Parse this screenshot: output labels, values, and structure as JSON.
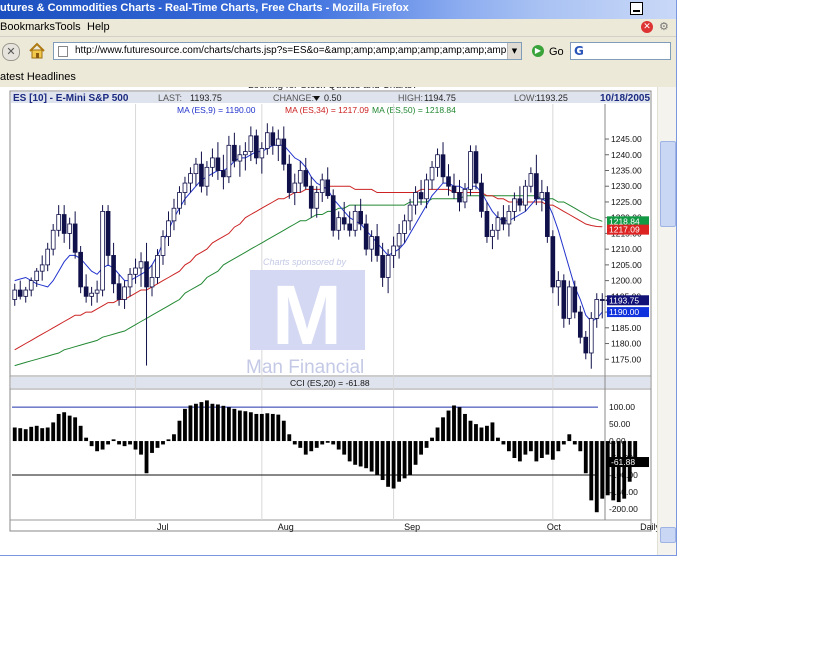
{
  "window": {
    "title": "utures & Commodities Charts - Real-Time Charts, Free Charts - Mozilla Firefox"
  },
  "menu": {
    "bookmarks": "Bookmarks",
    "tools": "Tools",
    "help": "Help"
  },
  "nav": {
    "url": "http://www.futuresource.com/charts/charts.jsp?s=ES&o=&amp;amp;amp;amp;amp;amp;amp;amp;a=D&z=",
    "go": "Go",
    "search_logo": "G"
  },
  "bookmarks_bar": {
    "item": "atest Headlines"
  },
  "page": {
    "top_cut_text": "Looking for Stock Quotes and Charts?"
  },
  "chart_data": {
    "type": "candlestick",
    "header": {
      "symbol": "ES [10] - E-Mini S&P 500",
      "last_label": "LAST:",
      "last": "1193.75",
      "change_label": "CHANGE:",
      "change": "0.50",
      "high_label": "HIGH:",
      "high": "1194.75",
      "low_label": "LOW:",
      "low": "1193.25",
      "date": "10/18/2005"
    },
    "ma_legend": [
      {
        "text": "MA (ES,9) = 1190.00",
        "color": "#2233cc"
      },
      {
        "text": "MA (ES,34) = 1217.09",
        "color": "#cc2222"
      },
      {
        "text": "MA (ES,50) = 1218.84",
        "color": "#228833"
      }
    ],
    "y_ticks": [
      "1245.00",
      "1240.00",
      "1235.00",
      "1230.00",
      "1225.00",
      "1220.00",
      "1215.00",
      "1210.00",
      "1205.00",
      "1200.00",
      "1195.00",
      "1190.00",
      "1185.00",
      "1180.00",
      "1175.00"
    ],
    "y_values": [
      1245,
      1240,
      1235,
      1230,
      1225,
      1220,
      1215,
      1210,
      1205,
      1200,
      1195,
      1190,
      1185,
      1180,
      1175
    ],
    "price_range": [
      1170,
      1252
    ],
    "price_labels": [
      {
        "text": "1218.84",
        "value": 1218.84,
        "bg": "#119944",
        "fg": "#ffffff"
      },
      {
        "text": "1217.09",
        "value": 1216.2,
        "bg": "#dd2222",
        "fg": "#ffffff"
      },
      {
        "text": "1193.75",
        "value": 1193.75,
        "bg": "#111177",
        "fg": "#ffffff"
      },
      {
        "text": "1190.00",
        "value": 1190.0,
        "bg": "#1133dd",
        "fg": "#ffffff"
      }
    ],
    "x_labels": [
      {
        "text": "Jul",
        "index": 27
      },
      {
        "text": "Aug",
        "index": 49
      },
      {
        "text": "Sep",
        "index": 72
      },
      {
        "text": "Oct",
        "index": 98
      },
      {
        "text": "Daily",
        "index": 115
      }
    ],
    "month_lines": [
      22,
      45,
      69,
      98
    ],
    "watermark": {
      "sponsored": "Charts sponsored by",
      "brand": "Man Financial",
      "letter": "M"
    },
    "candles": [
      [
        1194,
        1199,
        1192,
        1197
      ],
      [
        1197,
        1200,
        1194,
        1195
      ],
      [
        1195,
        1198,
        1193,
        1197
      ],
      [
        1197,
        1201,
        1195,
        1200
      ],
      [
        1200,
        1204,
        1198,
        1203
      ],
      [
        1203,
        1208,
        1200,
        1205
      ],
      [
        1205,
        1212,
        1203,
        1210
      ],
      [
        1210,
        1218,
        1208,
        1216
      ],
      [
        1216,
        1224,
        1214,
        1221
      ],
      [
        1221,
        1224,
        1212,
        1215
      ],
      [
        1215,
        1220,
        1210,
        1218
      ],
      [
        1218,
        1222,
        1207,
        1209
      ],
      [
        1209,
        1211,
        1196,
        1198
      ],
      [
        1198,
        1202,
        1193,
        1195
      ],
      [
        1195,
        1198,
        1192,
        1196
      ],
      [
        1196,
        1200,
        1193,
        1197
      ],
      [
        1197,
        1224,
        1195,
        1222
      ],
      [
        1222,
        1224,
        1205,
        1208
      ],
      [
        1208,
        1212,
        1196,
        1199
      ],
      [
        1199,
        1202,
        1192,
        1194
      ],
      [
        1194,
        1200,
        1191,
        1198
      ],
      [
        1198,
        1204,
        1195,
        1202
      ],
      [
        1202,
        1207,
        1199,
        1204
      ],
      [
        1204,
        1209,
        1198,
        1206
      ],
      [
        1206,
        1212,
        1173,
        1198
      ],
      [
        1198,
        1205,
        1195,
        1201
      ],
      [
        1201,
        1210,
        1199,
        1208
      ],
      [
        1208,
        1216,
        1205,
        1214
      ],
      [
        1214,
        1222,
        1211,
        1219
      ],
      [
        1219,
        1226,
        1216,
        1223
      ],
      [
        1223,
        1230,
        1221,
        1228
      ],
      [
        1228,
        1233,
        1224,
        1231
      ],
      [
        1231,
        1236,
        1228,
        1234
      ],
      [
        1234,
        1239,
        1230,
        1237
      ],
      [
        1237,
        1241,
        1228,
        1230
      ],
      [
        1230,
        1238,
        1227,
        1236
      ],
      [
        1236,
        1242,
        1233,
        1239
      ],
      [
        1239,
        1244,
        1232,
        1235
      ],
      [
        1235,
        1240,
        1229,
        1233
      ],
      [
        1233,
        1246,
        1231,
        1243
      ],
      [
        1243,
        1247,
        1236,
        1238
      ],
      [
        1238,
        1243,
        1233,
        1240
      ],
      [
        1240,
        1244,
        1235,
        1241
      ],
      [
        1241,
        1249,
        1238,
        1246
      ],
      [
        1246,
        1248,
        1237,
        1239
      ],
      [
        1239,
        1244,
        1234,
        1242
      ],
      [
        1242,
        1250,
        1240,
        1247
      ],
      [
        1247,
        1249,
        1240,
        1243
      ],
      [
        1243,
        1248,
        1238,
        1245
      ],
      [
        1245,
        1249,
        1235,
        1237
      ],
      [
        1237,
        1240,
        1226,
        1228
      ],
      [
        1228,
        1234,
        1224,
        1231
      ],
      [
        1231,
        1238,
        1228,
        1235
      ],
      [
        1235,
        1239,
        1229,
        1230
      ],
      [
        1230,
        1233,
        1220,
        1223
      ],
      [
        1223,
        1230,
        1220,
        1228
      ],
      [
        1228,
        1234,
        1225,
        1232
      ],
      [
        1232,
        1236,
        1226,
        1227
      ],
      [
        1227,
        1229,
        1214,
        1216
      ],
      [
        1216,
        1222,
        1213,
        1220
      ],
      [
        1220,
        1225,
        1216,
        1218
      ],
      [
        1218,
        1222,
        1214,
        1216
      ],
      [
        1216,
        1224,
        1214,
        1222
      ],
      [
        1222,
        1226,
        1216,
        1218
      ],
      [
        1218,
        1221,
        1208,
        1210
      ],
      [
        1210,
        1216,
        1206,
        1214
      ],
      [
        1214,
        1218,
        1206,
        1208
      ],
      [
        1208,
        1212,
        1198,
        1201
      ],
      [
        1201,
        1210,
        1196,
        1208
      ],
      [
        1208,
        1214,
        1204,
        1211
      ],
      [
        1211,
        1218,
        1207,
        1215
      ],
      [
        1215,
        1221,
        1212,
        1219
      ],
      [
        1219,
        1226,
        1216,
        1224
      ],
      [
        1224,
        1230,
        1221,
        1228
      ],
      [
        1228,
        1232,
        1224,
        1226
      ],
      [
        1226,
        1234,
        1223,
        1232
      ],
      [
        1232,
        1238,
        1229,
        1236
      ],
      [
        1236,
        1242,
        1233,
        1240
      ],
      [
        1240,
        1244,
        1231,
        1233
      ],
      [
        1233,
        1237,
        1227,
        1230
      ],
      [
        1230,
        1234,
        1226,
        1228
      ],
      [
        1228,
        1232,
        1222,
        1225
      ],
      [
        1225,
        1231,
        1223,
        1229
      ],
      [
        1229,
        1243,
        1227,
        1241
      ],
      [
        1241,
        1243,
        1229,
        1231
      ],
      [
        1231,
        1234,
        1220,
        1222
      ],
      [
        1222,
        1225,
        1212,
        1214
      ],
      [
        1214,
        1218,
        1210,
        1216
      ],
      [
        1216,
        1222,
        1213,
        1220
      ],
      [
        1220,
        1224,
        1216,
        1218
      ],
      [
        1218,
        1224,
        1214,
        1222
      ],
      [
        1222,
        1228,
        1219,
        1226
      ],
      [
        1226,
        1230,
        1222,
        1224
      ],
      [
        1224,
        1232,
        1222,
        1230
      ],
      [
        1230,
        1236,
        1228,
        1234
      ],
      [
        1234,
        1240,
        1224,
        1226
      ],
      [
        1226,
        1232,
        1222,
        1228
      ],
      [
        1228,
        1230,
        1212,
        1214
      ],
      [
        1214,
        1216,
        1196,
        1198
      ],
      [
        1198,
        1203,
        1192,
        1200
      ],
      [
        1200,
        1202,
        1185,
        1188
      ],
      [
        1188,
        1200,
        1186,
        1198
      ],
      [
        1198,
        1200,
        1188,
        1190
      ],
      [
        1190,
        1192,
        1180,
        1182
      ],
      [
        1182,
        1184,
        1175,
        1177
      ],
      [
        1177,
        1190,
        1172,
        1188
      ],
      [
        1188,
        1196,
        1185,
        1194
      ],
      [
        1194,
        1196,
        1188,
        1193.75
      ]
    ],
    "ma9": [
      1200,
      1200.5,
      1201,
      1200,
      1199,
      1198.5,
      1198,
      1200,
      1203,
      1206,
      1208,
      1208,
      1207,
      1205,
      1203,
      1202,
      1204,
      1205,
      1204,
      1202,
      1200,
      1200,
      1201,
      1202,
      1203,
      1205,
      1208,
      1212,
      1216,
      1220,
      1223,
      1226,
      1228,
      1230,
      1232,
      1233,
      1234,
      1235,
      1235,
      1236,
      1238,
      1239,
      1239,
      1240,
      1241,
      1241,
      1242,
      1243,
      1243,
      1243,
      1241,
      1239,
      1238,
      1236,
      1233,
      1231,
      1230,
      1229,
      1226,
      1224,
      1222,
      1220,
      1219,
      1218,
      1216,
      1214,
      1212,
      1210,
      1208,
      1209,
      1210,
      1212,
      1215,
      1218,
      1221,
      1224,
      1227,
      1229,
      1231,
      1231,
      1230,
      1230,
      1229,
      1230,
      1230,
      1228,
      1225,
      1222,
      1220,
      1219,
      1219,
      1220,
      1221,
      1222,
      1224,
      1226,
      1226,
      1225,
      1221,
      1216,
      1210,
      1204,
      1198,
      1194,
      1189,
      1187,
      1188,
      1190
    ],
    "ma34": [
      1178,
      1179,
      1180,
      1181,
      1182,
      1183,
      1184,
      1185,
      1186,
      1187,
      1188,
      1189,
      1189,
      1190,
      1190,
      1191,
      1192,
      1193,
      1193,
      1194,
      1194,
      1195,
      1196,
      1197,
      1197,
      1198,
      1199,
      1200,
      1201,
      1202,
      1203,
      1205,
      1206,
      1208,
      1209,
      1210,
      1212,
      1213,
      1214,
      1215,
      1217,
      1218,
      1220,
      1221,
      1222,
      1223,
      1224,
      1225,
      1226,
      1226,
      1227,
      1228,
      1228,
      1229,
      1229,
      1229,
      1229,
      1230,
      1230,
      1230,
      1230,
      1230,
      1229,
      1229,
      1229,
      1229,
      1228,
      1228,
      1228,
      1228,
      1228,
      1228,
      1228,
      1228,
      1229,
      1229,
      1229,
      1229,
      1229,
      1229,
      1228,
      1228,
      1228,
      1228,
      1228,
      1228,
      1227,
      1227,
      1226,
      1226,
      1225,
      1225,
      1225,
      1225,
      1225,
      1225,
      1225,
      1224,
      1224,
      1223,
      1222,
      1221,
      1220,
      1219,
      1218,
      1217.5,
      1217.2,
      1217.09
    ],
    "ma50": [
      1173,
      1173.5,
      1174,
      1174.5,
      1175,
      1175.5,
      1176,
      1176.5,
      1177,
      1178,
      1178.5,
      1179,
      1179.5,
      1180,
      1180.5,
      1181,
      1182,
      1182.5,
      1183,
      1183.5,
      1184,
      1185,
      1186,
      1187,
      1188,
      1189,
      1190,
      1191,
      1192,
      1193,
      1194,
      1196,
      1197,
      1198,
      1199,
      1201,
      1202,
      1203,
      1205,
      1206,
      1207,
      1208,
      1209,
      1210,
      1211,
      1212,
      1213,
      1214,
      1215,
      1216,
      1217,
      1218,
      1219,
      1219,
      1220,
      1221,
      1221,
      1222,
      1222,
      1223,
      1223,
      1224,
      1224,
      1224,
      1224,
      1224,
      1224,
      1224,
      1224,
      1224,
      1224,
      1224,
      1225,
      1225,
      1225,
      1225,
      1226,
      1226,
      1226,
      1226,
      1226,
      1226,
      1227,
      1227,
      1227,
      1227,
      1227,
      1227,
      1227,
      1227,
      1227,
      1227,
      1227,
      1227,
      1227,
      1227,
      1226,
      1226,
      1226,
      1225,
      1225,
      1224,
      1223,
      1222,
      1221,
      1220,
      1219.5,
      1218.84
    ],
    "cci": {
      "label": "CCI (ES,20) = -61.88",
      "last_label": "-61.88",
      "last": -61.88,
      "range": [
        -230,
        130
      ],
      "ticks": [
        "100.00",
        "50.00",
        "0.00",
        "-50.00",
        "-100.00",
        "-150.00",
        "-200.00"
      ],
      "tick_values": [
        100,
        50,
        0,
        -50,
        -100,
        -150,
        -200
      ],
      "guide_lines": [
        100,
        -100
      ],
      "values": [
        40,
        38,
        35,
        42,
        45,
        38,
        40,
        55,
        80,
        85,
        75,
        70,
        45,
        10,
        -15,
        -30,
        -25,
        -10,
        5,
        -10,
        -15,
        -10,
        -25,
        -40,
        -95,
        -35,
        -20,
        -10,
        5,
        20,
        60,
        95,
        105,
        110,
        115,
        120,
        110,
        108,
        104,
        100,
        95,
        90,
        88,
        85,
        80,
        80,
        82,
        80,
        78,
        60,
        20,
        -10,
        -20,
        -40,
        -30,
        -20,
        -10,
        -5,
        -10,
        -25,
        -40,
        -60,
        -70,
        -75,
        -80,
        -90,
        -100,
        -115,
        -135,
        -140,
        -120,
        -110,
        -100,
        -70,
        -40,
        -20,
        10,
        40,
        70,
        90,
        105,
        100,
        80,
        60,
        50,
        40,
        45,
        55,
        10,
        -10,
        -30,
        -50,
        -60,
        -40,
        -30,
        -60,
        -50,
        -40,
        -55,
        -30,
        -10,
        20,
        -10,
        -30,
        -95,
        -175,
        -210,
        -170,
        -160,
        -175,
        -180,
        -170,
        -120,
        -61.88
      ]
    }
  }
}
